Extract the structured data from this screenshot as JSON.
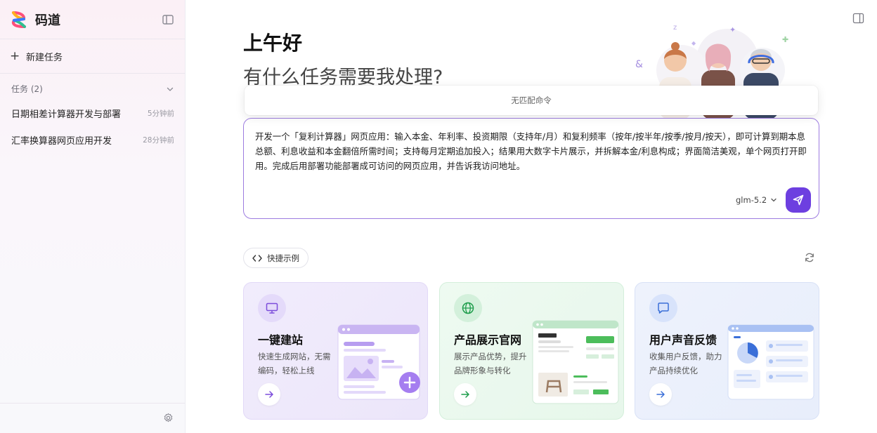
{
  "app": {
    "name": "码道"
  },
  "sidebar": {
    "new_task_label": "新建任务",
    "tasks_header": "任务 (2)",
    "tasks": [
      {
        "title": "日期相差计算器开发与部署",
        "time": "5分钟前"
      },
      {
        "title": "汇率换算器网页应用开发",
        "time": "28分钟前"
      }
    ]
  },
  "main": {
    "greeting": "上午好",
    "question": "有什么任务需要我处理?",
    "command_dropdown": {
      "text": "无匹配命令"
    },
    "composer": {
      "text": "开发一个「复利计算器」网页应用：输入本金、年利率、投资期限（支持年/月）和复利频率（按年/按半年/按季/按月/按天），即可计算到期本息总额、利息收益和本金翻倍所需时间；支持每月定期追加投入；结果用大数字卡片展示，并拆解本金/利息构成；界面简洁美观，单个网页打开即用。完成后用部署功能部署成可访问的网页应用，并告诉我访问地址。",
      "model": "glm-5.2"
    },
    "quick_examples_label": "快捷示例",
    "cards": [
      {
        "title": "一键建站",
        "desc": "快速生成网站，无需编码，轻松上线",
        "icon": "monitor-icon",
        "color": "#7c4ddb"
      },
      {
        "title": "产品展示官网",
        "desc": "展示产品优势，提升品牌形象与转化",
        "icon": "globe-icon",
        "color": "#1f9d4c"
      },
      {
        "title": "用户声音反馈",
        "desc": "收集用户反馈，助力产品持续优化",
        "icon": "chat-icon",
        "color": "#3a6fd8"
      }
    ]
  },
  "colors": {
    "accent": "#6d3fe0",
    "composer_border": "#9d7ce0"
  }
}
